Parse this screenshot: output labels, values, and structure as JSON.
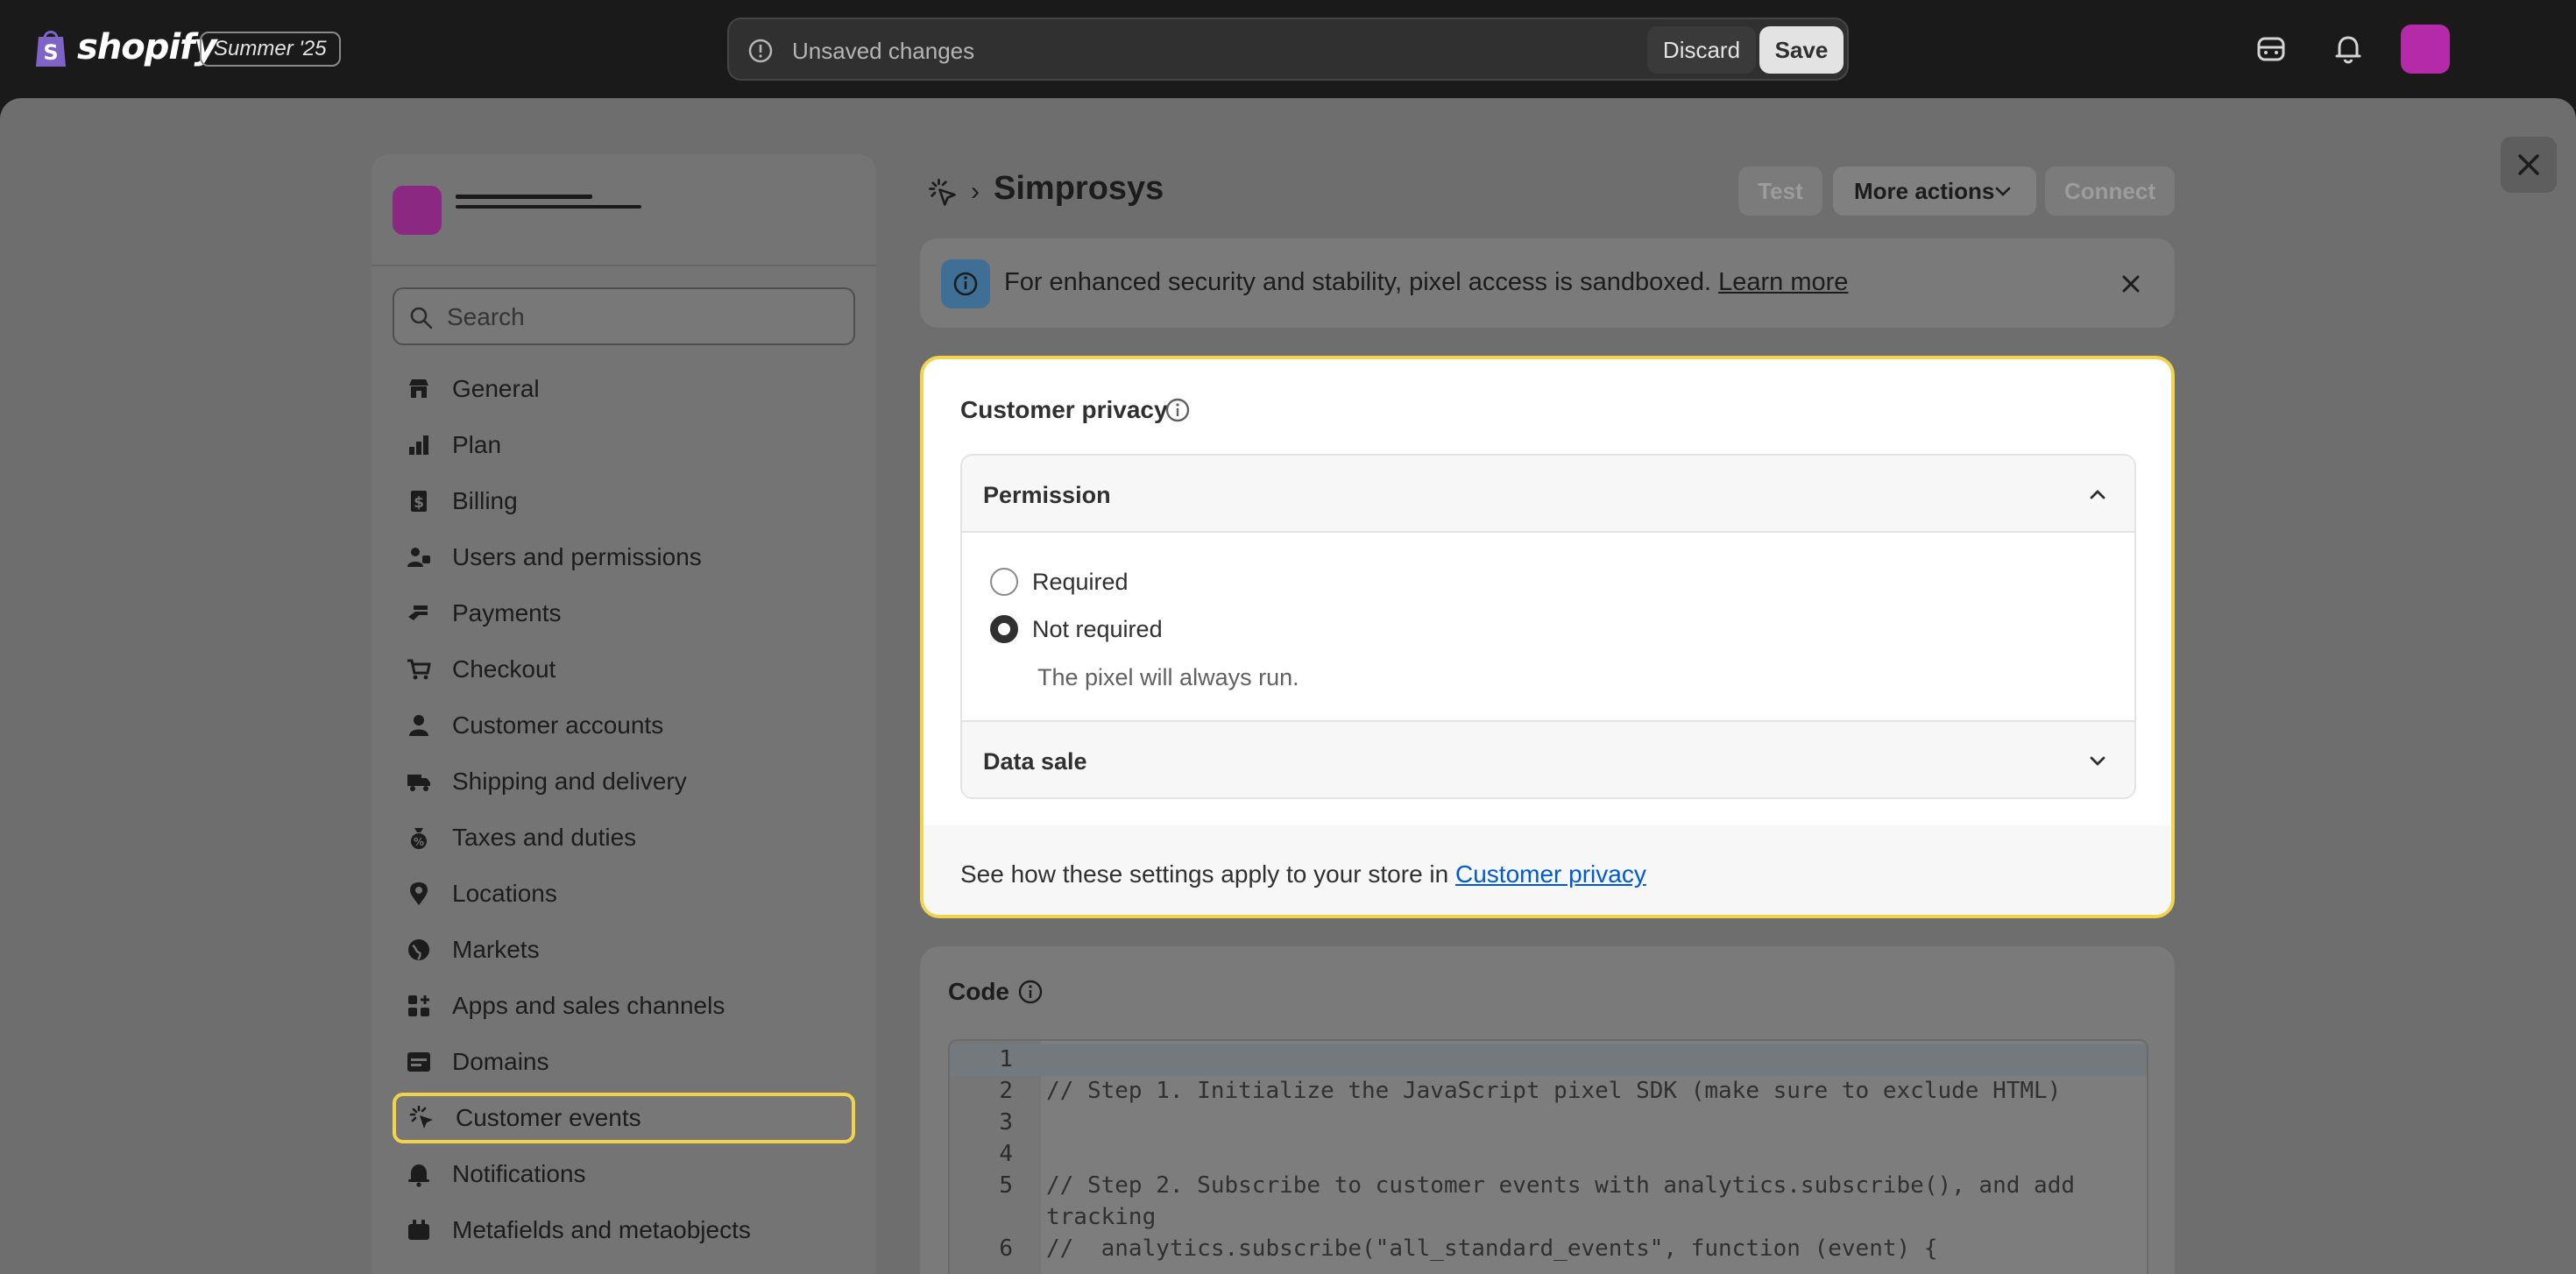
{
  "topbar": {
    "brand": "shopify",
    "edition_badge": "Summer '25",
    "unsaved_text": "Unsaved changes",
    "discard_label": "Discard",
    "save_label": "Save",
    "icons": [
      "search-orders-icon",
      "bell-icon"
    ],
    "colors": {
      "bar": "#1a1a1a",
      "avatar": "#b42aa8"
    }
  },
  "sidebar": {
    "search_placeholder": "Search",
    "items": [
      {
        "label": "General",
        "icon": "store-icon"
      },
      {
        "label": "Plan",
        "icon": "plan-icon"
      },
      {
        "label": "Billing",
        "icon": "billing-icon"
      },
      {
        "label": "Users and permissions",
        "icon": "users-icon"
      },
      {
        "label": "Payments",
        "icon": "payments-icon"
      },
      {
        "label": "Checkout",
        "icon": "cart-icon"
      },
      {
        "label": "Customer accounts",
        "icon": "person-icon"
      },
      {
        "label": "Shipping and delivery",
        "icon": "truck-icon"
      },
      {
        "label": "Taxes and duties",
        "icon": "tax-icon"
      },
      {
        "label": "Locations",
        "icon": "location-icon"
      },
      {
        "label": "Markets",
        "icon": "globe-icon"
      },
      {
        "label": "Apps and sales channels",
        "icon": "apps-icon"
      },
      {
        "label": "Domains",
        "icon": "domains-icon"
      },
      {
        "label": "Customer events",
        "icon": "cursor-click-icon",
        "active": true
      },
      {
        "label": "Notifications",
        "icon": "bell-icon"
      },
      {
        "label": "Metafields and metaobjects",
        "icon": "metafields-icon"
      }
    ]
  },
  "page": {
    "title": "Simprosys",
    "test_label": "Test",
    "more_actions_label": "More actions",
    "connect_label": "Connect"
  },
  "banner": {
    "text": "For enhanced security and stability, pixel access is sandboxed.",
    "link": "Learn more"
  },
  "privacy": {
    "title": "Customer privacy",
    "permission_heading": "Permission",
    "options": [
      {
        "label": "Required",
        "checked": false
      },
      {
        "label": "Not required",
        "checked": true
      }
    ],
    "help_text": "The pixel will always run.",
    "data_sale_heading": "Data sale",
    "footer_text": "See how these settings apply to your store in",
    "footer_link": "Customer privacy",
    "colors": {
      "highlight": "#f1d44b",
      "link": "#005bd3"
    }
  },
  "code": {
    "title": "Code",
    "lines": [
      {
        "n": "1",
        "text": ""
      },
      {
        "n": "2",
        "text": "// Step 1. Initialize the JavaScript pixel SDK (make sure to exclude HTML)"
      },
      {
        "n": "3",
        "text": ""
      },
      {
        "n": "4",
        "text": ""
      },
      {
        "n": "5",
        "text": "// Step 2. Subscribe to customer events with analytics.subscribe(), and add"
      },
      {
        "n": "",
        "text": "tracking"
      },
      {
        "n": "6",
        "text": "//  analytics.subscribe(\"all_standard_events\", function (event) {"
      }
    ]
  }
}
